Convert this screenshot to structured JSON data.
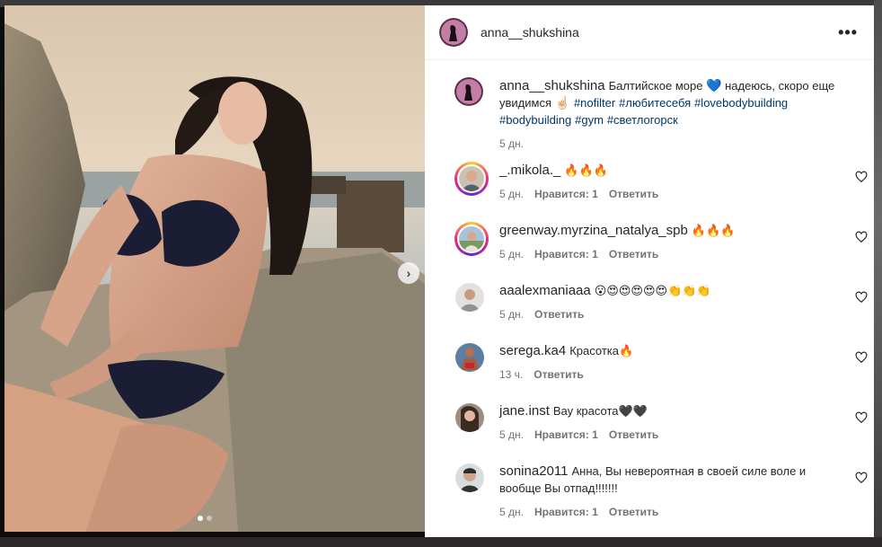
{
  "post": {
    "author": "anna__shukshina",
    "caption": {
      "prefix": "Балтийское море ",
      "heart_emoji": "💙",
      "after_heart": " надеюсь, скоро еще увидимся ",
      "hand_emoji": "☝🏻",
      "hashtags": [
        "#nofilter",
        "#любитесебя",
        "#lovebodybuilding",
        "#bodybuilding",
        "#gym",
        "#светлогорск"
      ]
    },
    "time": "5 дн."
  },
  "ui": {
    "more_icon": "•••",
    "next_arrow": "›"
  },
  "comments": [
    {
      "user": "_.mikola._",
      "text": "🔥🔥🔥",
      "time": "5 дн.",
      "likes": "Нравится: 1",
      "reply": "Ответить",
      "ring": true
    },
    {
      "user": "greenway.myrzina_natalya_spb",
      "text": "🔥🔥🔥",
      "time": "5 дн.",
      "likes": "Нравится: 1",
      "reply": "Ответить",
      "ring": true
    },
    {
      "user": "aaalexmaniaaa",
      "text": "😮😍😍😍😍😍👏👏👏",
      "time": "5 дн.",
      "likes": "",
      "reply": "Ответить",
      "ring": false
    },
    {
      "user": "serega.ka4",
      "text": "Красотка🔥",
      "time": "13 ч.",
      "likes": "",
      "reply": "Ответить",
      "ring": false
    },
    {
      "user": "jane.inst",
      "text": "Вау красота🖤🖤",
      "time": "5 дн.",
      "likes": "Нравится: 1",
      "reply": "Ответить",
      "ring": false
    },
    {
      "user": "sonina2011",
      "text": "Анна, Вы невероятная в своей силе воле и вообще Вы отпад!!!!!!!",
      "time": "5 дн.",
      "likes": "Нравится: 1",
      "reply": "Ответить",
      "ring": false
    }
  ],
  "colors": {
    "link": "#00376b",
    "meta": "#737373",
    "text": "#262626"
  }
}
